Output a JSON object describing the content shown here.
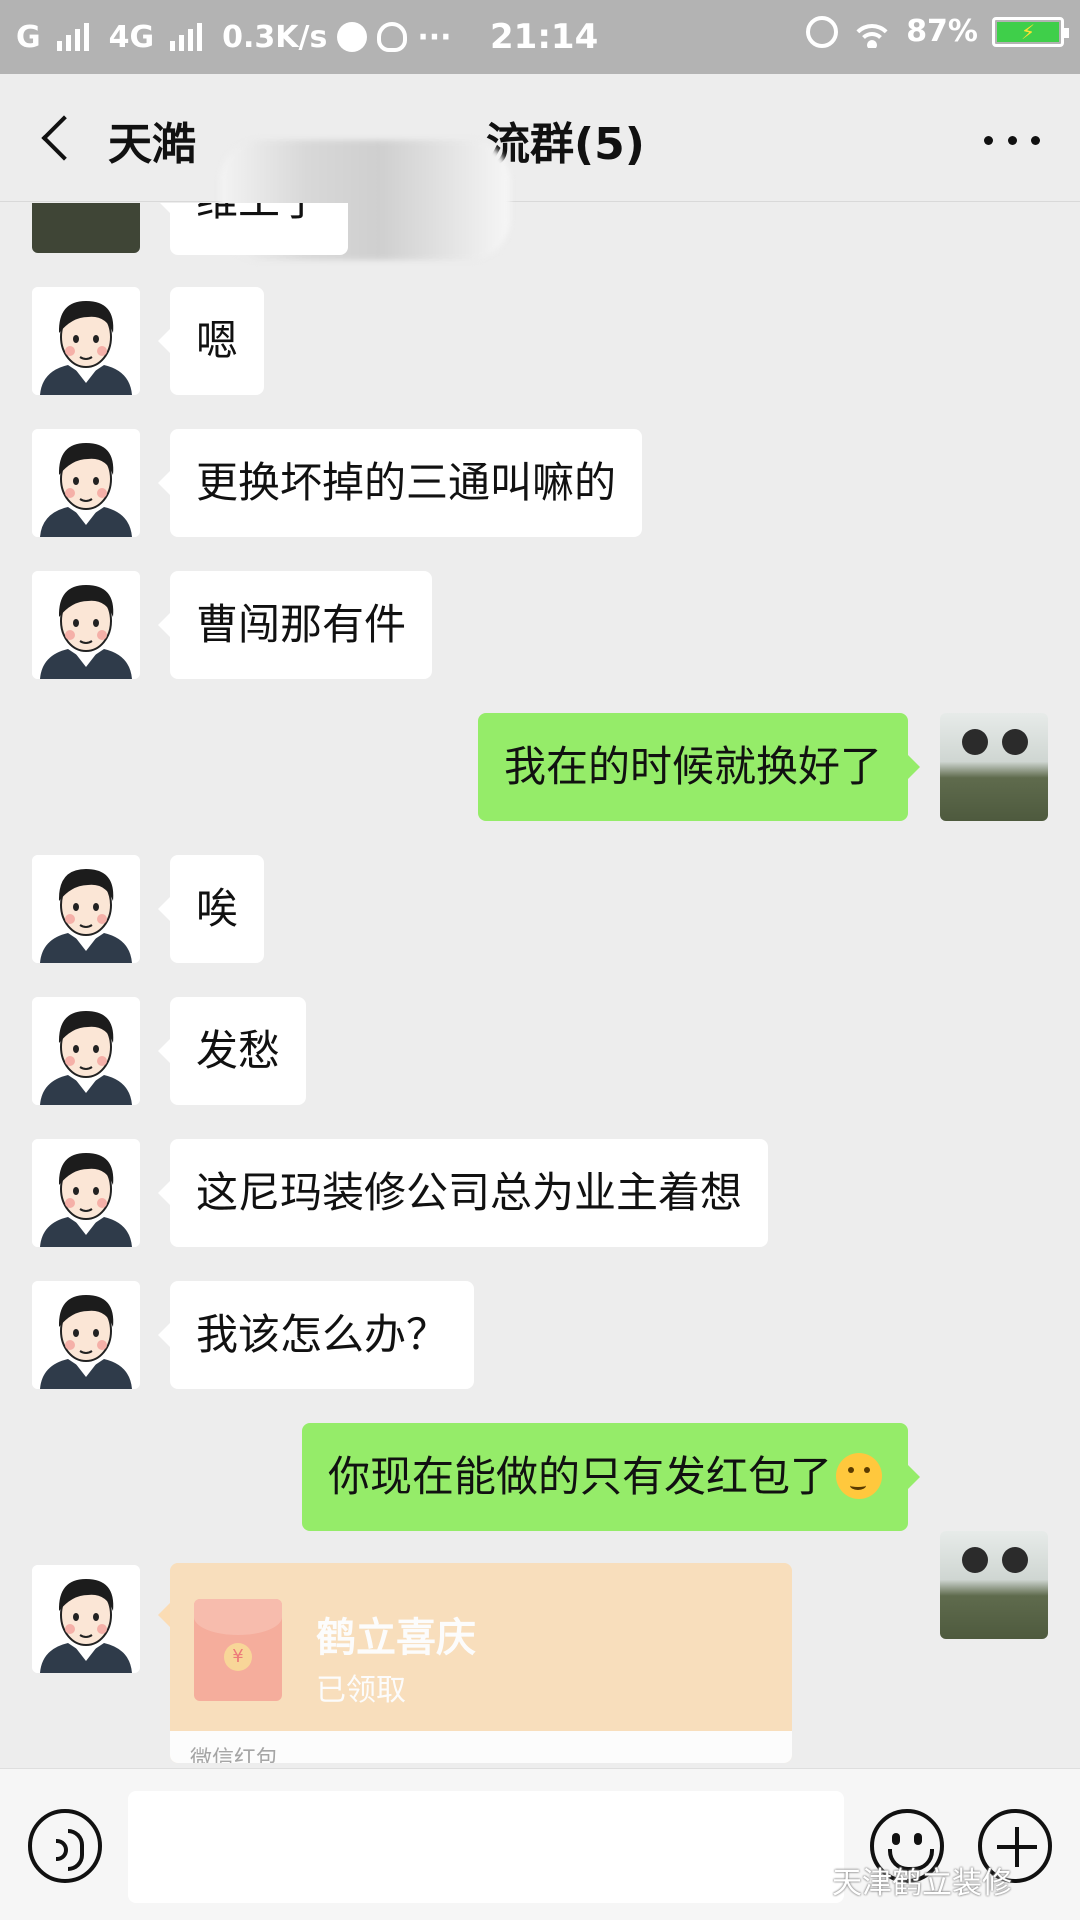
{
  "status_bar": {
    "network1": "G",
    "network2": "4G",
    "speed": "0.3K/s",
    "dots": "···",
    "time": "21:14",
    "battery": "87%"
  },
  "header": {
    "title_start": "天澔",
    "title_end": "流群(5)"
  },
  "messages": [
    {
      "side": "in",
      "text": "维工了"
    },
    {
      "side": "in",
      "text": "嗯"
    },
    {
      "side": "in",
      "text": "更换坏掉的三通叫嘛的"
    },
    {
      "side": "in",
      "text": "曹闯那有件"
    },
    {
      "side": "out",
      "text": "我在的时候就换好了"
    },
    {
      "side": "in",
      "text": "唉"
    },
    {
      "side": "in",
      "text": "发愁"
    },
    {
      "side": "in",
      "text": "这尼玛装修公司总为业主着想"
    },
    {
      "side": "in",
      "text": "我该怎么办？"
    },
    {
      "side": "out",
      "text": "你现在能做的只有发红包了"
    }
  ],
  "red_packet": {
    "title": "鹤立喜庆",
    "status": "已领取",
    "label": "微信红包",
    "coin": "¥"
  },
  "watermark": "天津鹤立装修",
  "colors": {
    "outgoing_bubble": "#95ec69",
    "incoming_bubble": "#ffffff",
    "background": "#ededed",
    "status_bar": "#b3b3b3",
    "red_packet": "#fbdcb4"
  }
}
